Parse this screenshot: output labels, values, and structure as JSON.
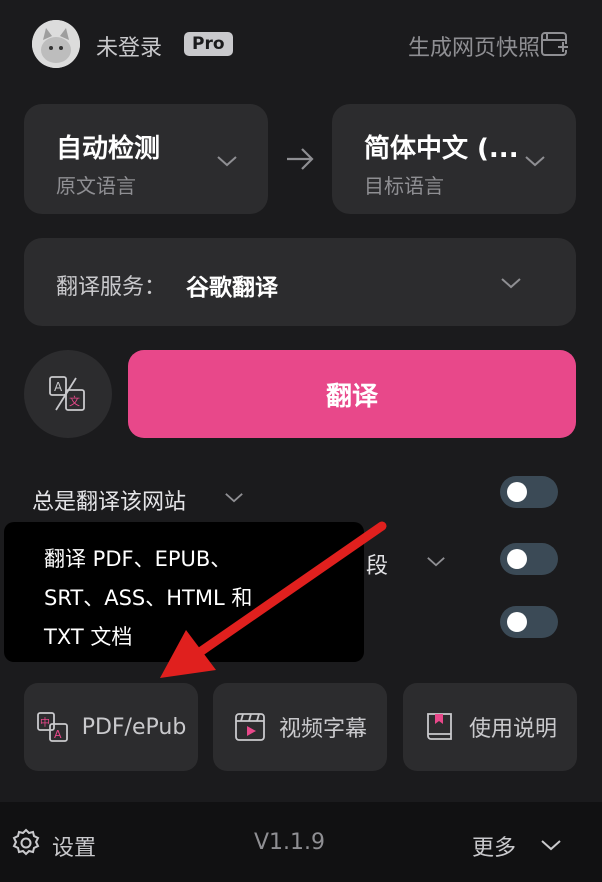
{
  "header": {
    "user_label": "未登录",
    "badge": "Pro",
    "snapshot_label": "生成网页快照"
  },
  "languages": {
    "source": {
      "title": "自动检测",
      "subtitle": "原文语言"
    },
    "target": {
      "title": "简体中文 (...",
      "subtitle": "目标语言"
    }
  },
  "service": {
    "label": "翻译服务：",
    "value": "谷歌翻译"
  },
  "translate_label": "翻译",
  "options": {
    "always_translate_site": "总是翻译该网站",
    "partial_visible": "段"
  },
  "tooltip": {
    "lines": [
      "翻译 PDF、EPUB、",
      "SRT、ASS、HTML 和",
      "TXT 文档"
    ]
  },
  "tools": [
    {
      "label": "PDF/ePub",
      "icon": "pdf-translate-icon"
    },
    {
      "label": "视频字幕",
      "icon": "video-subtitle-icon"
    },
    {
      "label": "使用说明",
      "icon": "book-icon"
    }
  ],
  "footer": {
    "settings_label": "设置",
    "version": "V1.1.9",
    "more_label": "更多"
  },
  "colors": {
    "background": "#1b1b1d",
    "card": "#2c2c2e",
    "accent": "#e8488a",
    "toggle_off": "#3b4a56",
    "annotation_arrow": "#e0201e"
  }
}
